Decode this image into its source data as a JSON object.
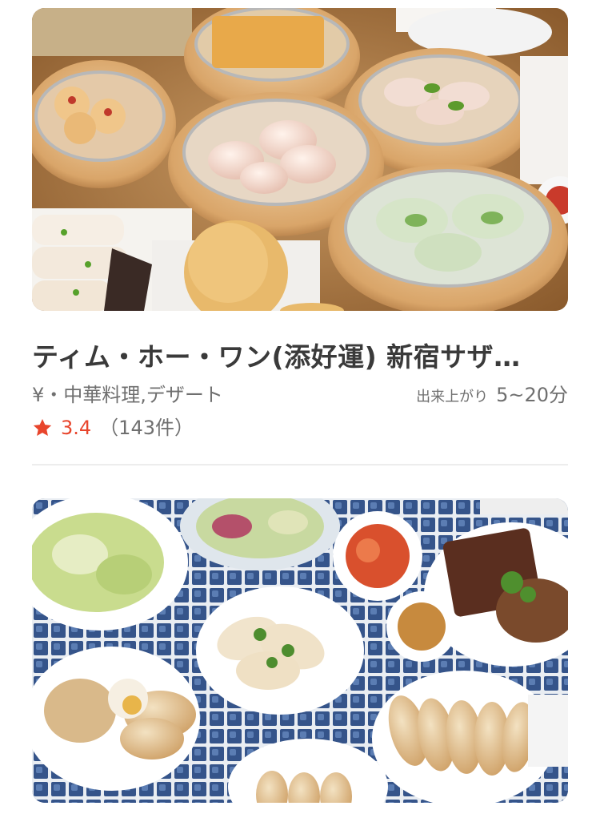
{
  "restaurants": [
    {
      "title": "ティム・ホー・ワン(添好運) 新宿サザ…",
      "meta": "¥・中華料理,デザート",
      "eta_label": "出来上がり",
      "eta_value": "5~20分",
      "rating": "3.4",
      "review_count": "（143件）",
      "image": "dim-sum-photo"
    },
    {
      "image": "gyoza-photo"
    }
  ],
  "colors": {
    "rating_accent": "#e8452c",
    "divider": "#ededed"
  },
  "icons": {
    "rating": "star-icon"
  }
}
